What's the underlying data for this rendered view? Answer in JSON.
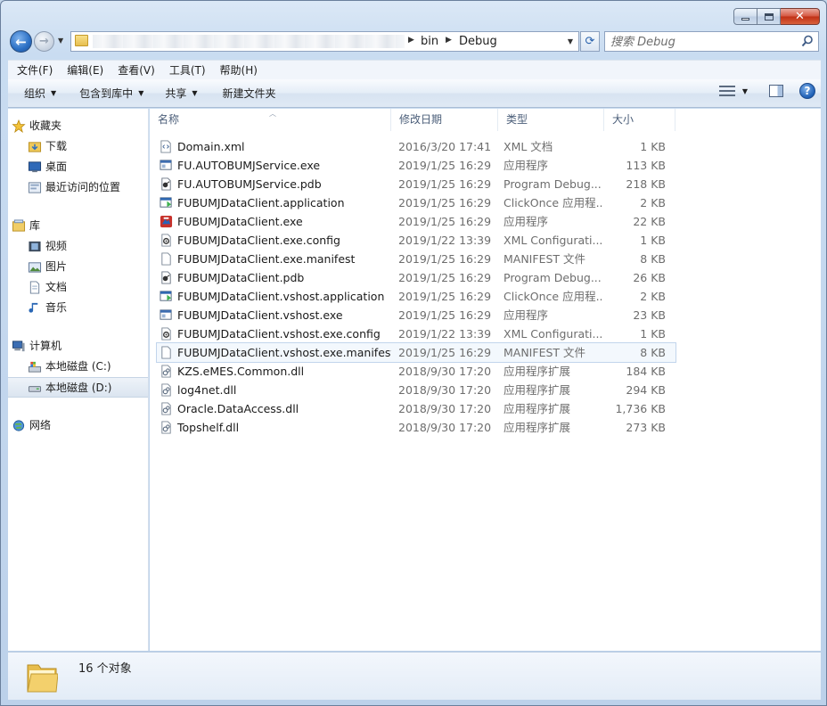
{
  "window": {
    "caption": {
      "min": "",
      "max": "",
      "close": "✕"
    }
  },
  "address": {
    "crumbs": [
      "bin",
      "Debug"
    ]
  },
  "search": {
    "placeholder": "搜索 Debug"
  },
  "menu": [
    "文件(F)",
    "编辑(E)",
    "查看(V)",
    "工具(T)",
    "帮助(H)"
  ],
  "commands": [
    {
      "label": "组织",
      "dropdown": true
    },
    {
      "label": "包含到库中",
      "dropdown": true
    },
    {
      "label": "共享",
      "dropdown": true
    },
    {
      "label": "新建文件夹",
      "dropdown": false
    }
  ],
  "nav": {
    "favorites": {
      "label": "收藏夹",
      "items": [
        "下载",
        "桌面",
        "最近访问的位置"
      ]
    },
    "libraries": {
      "label": "库",
      "items": [
        "视频",
        "图片",
        "文档",
        "音乐"
      ]
    },
    "computer": {
      "label": "计算机",
      "items": [
        "本地磁盘 (C:)",
        "本地磁盘 (D:)"
      ]
    },
    "network": {
      "label": "网络"
    }
  },
  "columns": {
    "name": "名称",
    "date": "修改日期",
    "type": "类型",
    "size": "大小"
  },
  "files": [
    {
      "name": "Domain.xml",
      "date": "2016/3/20 17:41",
      "type": "XML 文档",
      "size": "1 KB",
      "icon": "xml-icon"
    },
    {
      "name": "FU.AUTOBUMJService.exe",
      "date": "2019/1/25 16:29",
      "type": "应用程序",
      "size": "113 KB",
      "icon": "exe-icon"
    },
    {
      "name": "FU.AUTOBUMJService.pdb",
      "date": "2019/1/25 16:29",
      "type": "Program Debug...",
      "size": "218 KB",
      "icon": "pdb-icon"
    },
    {
      "name": "FUBUMJDataClient.application",
      "date": "2019/1/25 16:29",
      "type": "ClickOnce 应用程...",
      "size": "2 KB",
      "icon": "clickonce-icon"
    },
    {
      "name": "FUBUMJDataClient.exe",
      "date": "2019/1/25 16:29",
      "type": "应用程序",
      "size": "22 KB",
      "icon": "app-exe-icon"
    },
    {
      "name": "FUBUMJDataClient.exe.config",
      "date": "2019/1/22 13:39",
      "type": "XML Configurati...",
      "size": "1 KB",
      "icon": "config-icon"
    },
    {
      "name": "FUBUMJDataClient.exe.manifest",
      "date": "2019/1/25 16:29",
      "type": "MANIFEST 文件",
      "size": "8 KB",
      "icon": "manifest-icon"
    },
    {
      "name": "FUBUMJDataClient.pdb",
      "date": "2019/1/25 16:29",
      "type": "Program Debug...",
      "size": "26 KB",
      "icon": "pdb-icon"
    },
    {
      "name": "FUBUMJDataClient.vshost.application",
      "date": "2019/1/25 16:29",
      "type": "ClickOnce 应用程...",
      "size": "2 KB",
      "icon": "clickonce-icon"
    },
    {
      "name": "FUBUMJDataClient.vshost.exe",
      "date": "2019/1/25 16:29",
      "type": "应用程序",
      "size": "23 KB",
      "icon": "exe-icon"
    },
    {
      "name": "FUBUMJDataClient.vshost.exe.config",
      "date": "2019/1/22 13:39",
      "type": "XML Configurati...",
      "size": "1 KB",
      "icon": "config-icon"
    },
    {
      "name": "FUBUMJDataClient.vshost.exe.manifest",
      "date": "2019/1/25 16:29",
      "type": "MANIFEST 文件",
      "size": "8 KB",
      "icon": "manifest-icon"
    },
    {
      "name": "KZS.eMES.Common.dll",
      "date": "2018/9/30 17:20",
      "type": "应用程序扩展",
      "size": "184 KB",
      "icon": "dll-icon"
    },
    {
      "name": "log4net.dll",
      "date": "2018/9/30 17:20",
      "type": "应用程序扩展",
      "size": "294 KB",
      "icon": "dll-icon"
    },
    {
      "name": "Oracle.DataAccess.dll",
      "date": "2018/9/30 17:20",
      "type": "应用程序扩展",
      "size": "1,736 KB",
      "icon": "dll-icon"
    },
    {
      "name": "Topshelf.dll",
      "date": "2018/9/30 17:20",
      "type": "应用程序扩展",
      "size": "273 KB",
      "icon": "dll-icon"
    }
  ],
  "hovered_row": 11,
  "details": {
    "count": "16 个对象"
  }
}
